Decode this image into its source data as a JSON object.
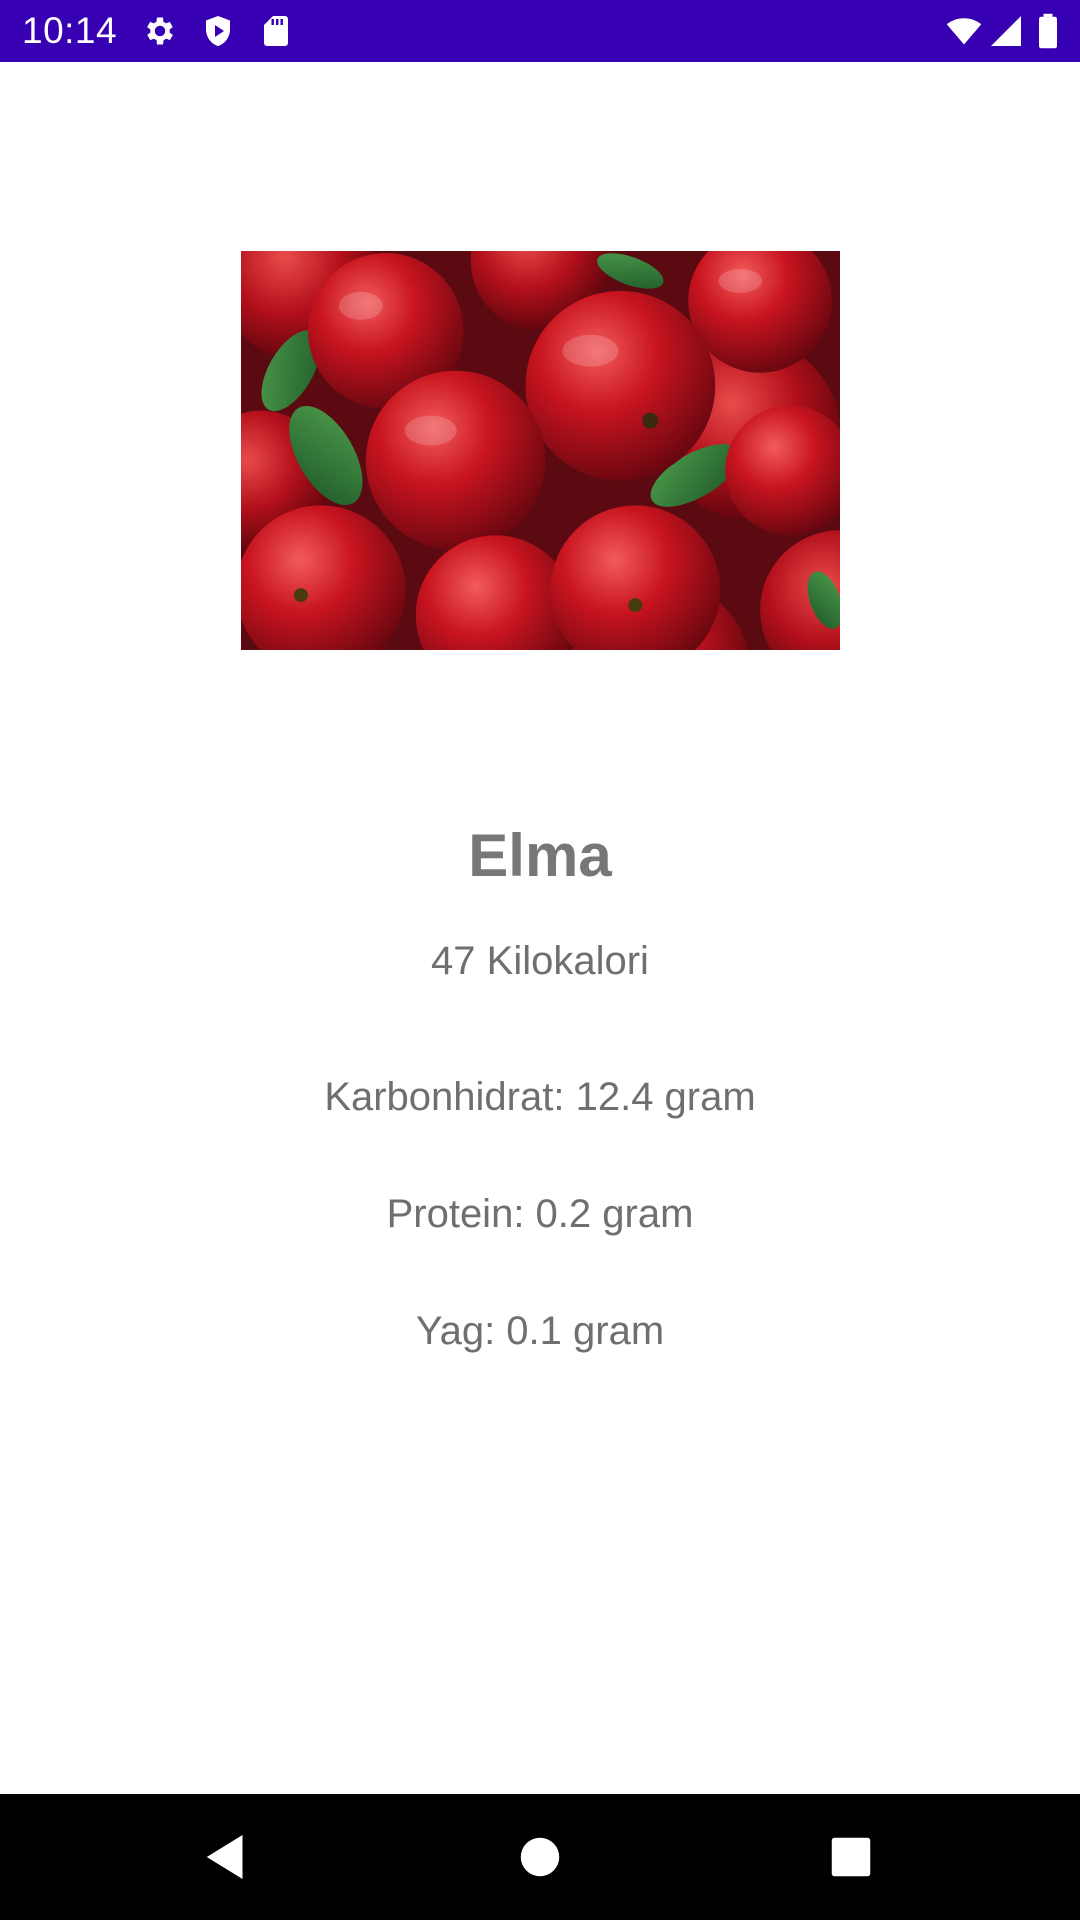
{
  "status_bar": {
    "time": "10:14",
    "background_color": "#3700b3",
    "left_icons": [
      "gear-icon",
      "shield-icon",
      "sd-card-icon"
    ],
    "right_icons": [
      "wifi-icon",
      "cellular-signal-icon",
      "battery-icon"
    ]
  },
  "food": {
    "image_alt": "red apples with leaves",
    "name": "Elma",
    "calories": "47 Kilokalori",
    "nutrients": {
      "carbs": "Karbonhidrat: 12.4 gram",
      "protein": "Protein: 0.2 gram",
      "fat": "Yag: 0.1 gram"
    }
  },
  "nav_bar": {
    "buttons": [
      "back-icon",
      "home-icon",
      "recents-icon"
    ]
  }
}
